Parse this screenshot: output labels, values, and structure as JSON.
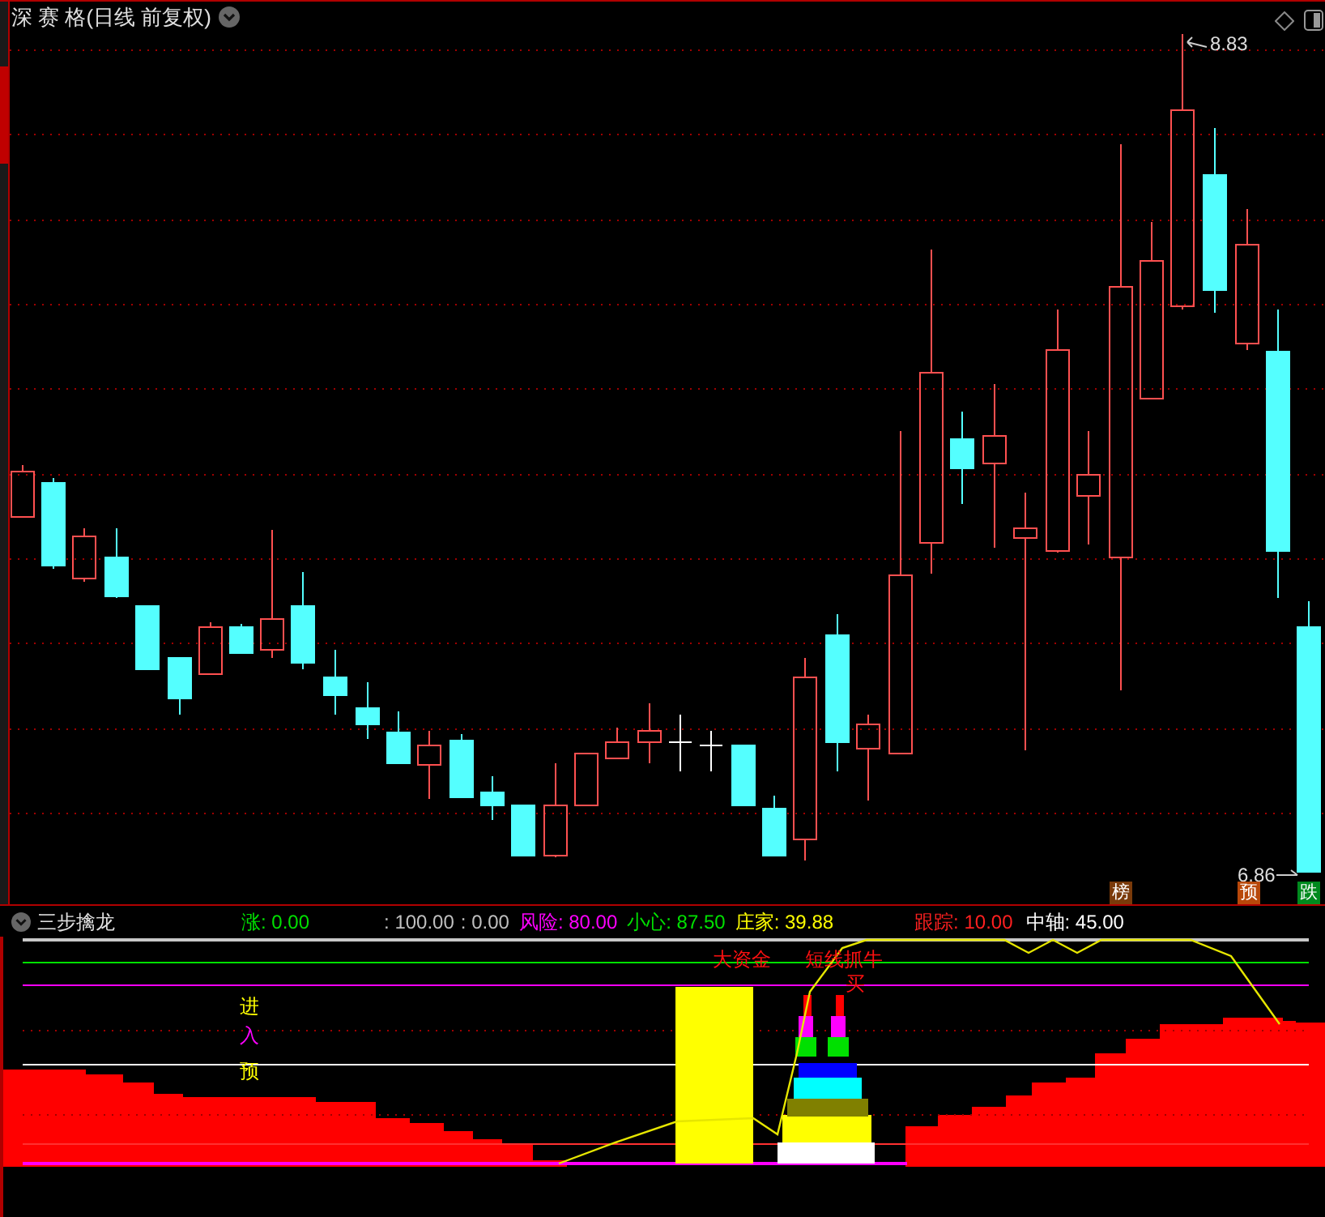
{
  "chart": {
    "title": "深 赛 格(日线 前复权)",
    "high_label": "8.83",
    "low_label": "6.86",
    "markers": [
      {
        "text": "榜",
        "color": "#7a3a0a"
      },
      {
        "text": "预",
        "color": "#b8480a"
      },
      {
        "text": "跌",
        "color": "#008a1e"
      }
    ]
  },
  "indicator": {
    "name": "三步擒龙",
    "values": [
      {
        "text": "涨: 0.00",
        "color": "#00e000"
      },
      {
        "text": ": 100.00",
        "color": "#c0c0c0"
      },
      {
        "text": ": 0.00",
        "color": "#c0c0c0"
      },
      {
        "text": "风险: 80.00",
        "color": "#ff00ff"
      },
      {
        "text": "小心: 87.50",
        "color": "#00e000"
      },
      {
        "text": "庄家: 39.88",
        "color": "#ffff00"
      },
      {
        "text": "跟踪: 10.00",
        "color": "#ff2020"
      },
      {
        "text": "中轴: 45.00",
        "color": "#ffffff"
      }
    ],
    "side_labels": [
      {
        "text": "进",
        "color": "#ffff00"
      },
      {
        "text": "入",
        "color": "#ff00ff"
      },
      {
        "text": "预",
        "color": "#ffff00"
      }
    ],
    "annotations": [
      "大资金",
      "短线抓牛",
      "买"
    ]
  }
}
